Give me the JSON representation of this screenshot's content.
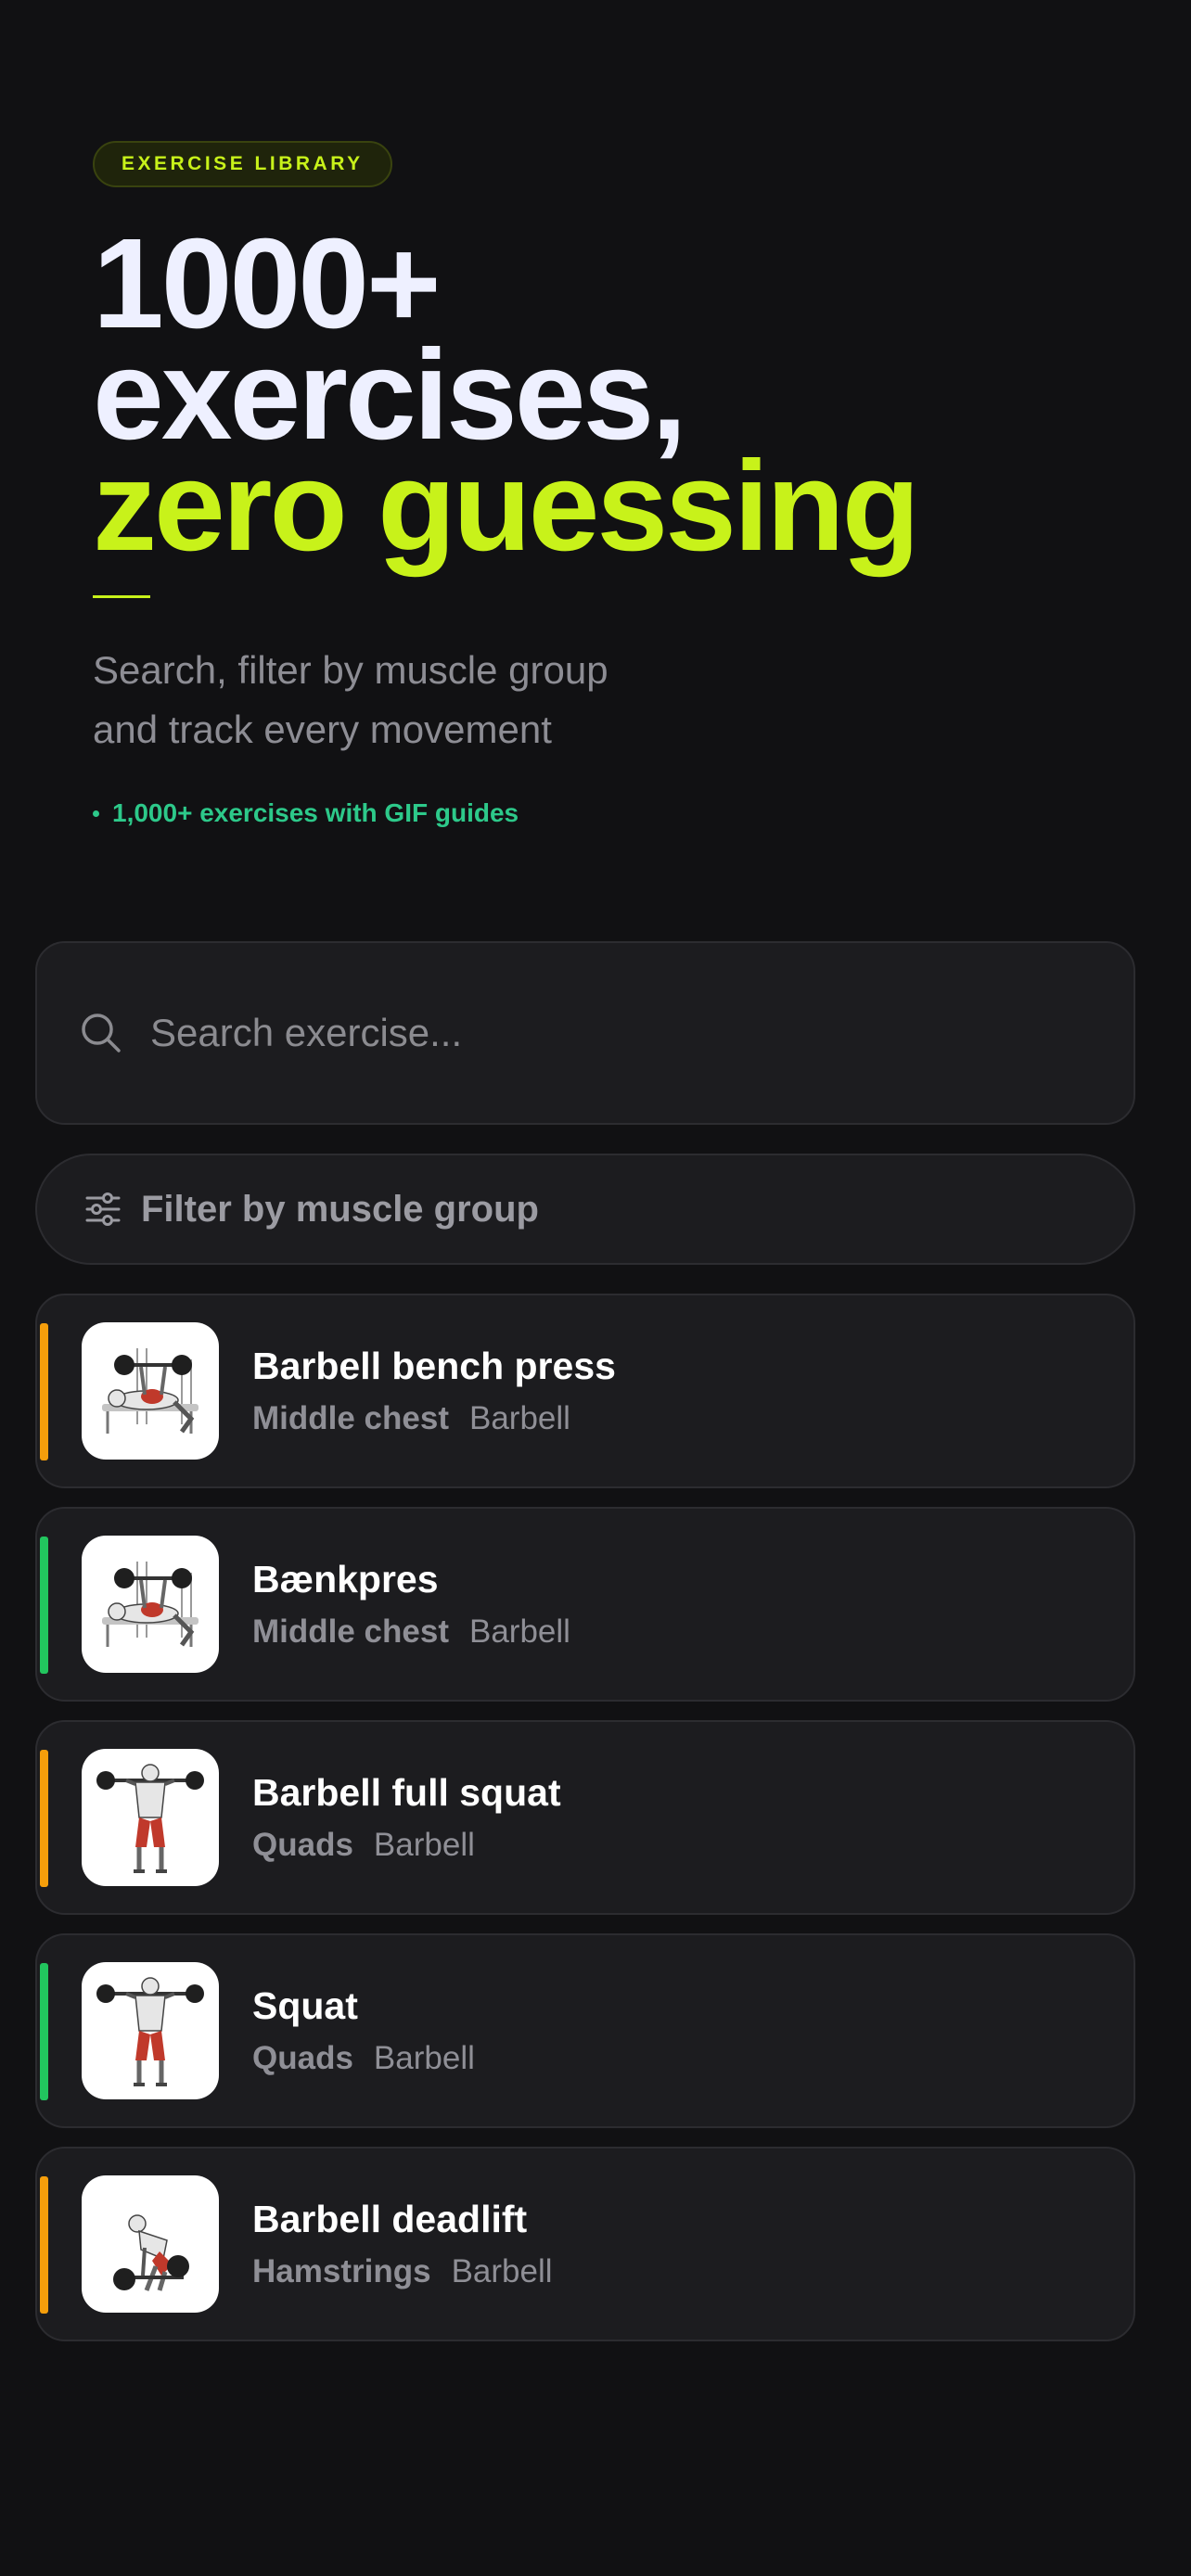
{
  "colors": {
    "background": "#111113",
    "accent": "#c8f21a",
    "feature_green": "#2dc98a",
    "stripe_orange": "#f59e0b",
    "stripe_green": "#22c55e",
    "card_bg": "#1c1c1f"
  },
  "hero": {
    "badge": "EXERCISE LIBRARY",
    "headline_line1": "1000+",
    "headline_line2": "exercises,",
    "headline_line3": "zero guessing",
    "subtitle_line1": "Search, filter by muscle group",
    "subtitle_line2": "and track every movement",
    "feature": "1,000+ exercises with GIF guides"
  },
  "search": {
    "icon": "search-icon",
    "placeholder": "Search exercise...",
    "value": ""
  },
  "filter": {
    "icon": "sliders-icon",
    "label": "Filter by muscle group"
  },
  "exercises": [
    {
      "name": "Barbell bench press",
      "muscle": "Middle chest",
      "equipment": "Barbell",
      "stripe": "orange",
      "thumb": "bench-press-illustration"
    },
    {
      "name": "Bænkpres",
      "muscle": "Middle chest",
      "equipment": "Barbell",
      "stripe": "green",
      "thumb": "bench-press-illustration"
    },
    {
      "name": "Barbell full squat",
      "muscle": "Quads",
      "equipment": "Barbell",
      "stripe": "orange",
      "thumb": "squat-illustration"
    },
    {
      "name": "Squat",
      "muscle": "Quads",
      "equipment": "Barbell",
      "stripe": "green",
      "thumb": "squat-illustration"
    },
    {
      "name": "Barbell deadlift",
      "muscle": "Hamstrings",
      "equipment": "Barbell",
      "stripe": "orange",
      "thumb": "deadlift-illustration"
    }
  ]
}
